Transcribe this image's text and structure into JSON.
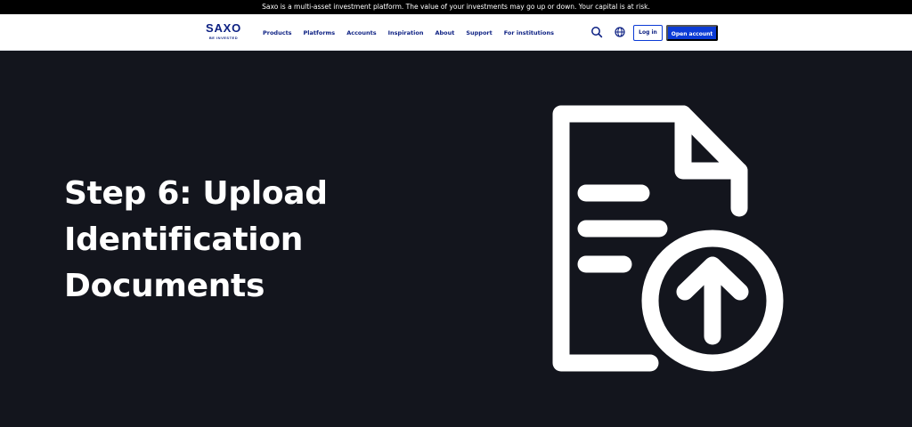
{
  "risk_banner": "Saxo is a multi-asset investment platform. The value of your investments may go up or down. Your capital is at risk.",
  "logo": {
    "name": "SAXO",
    "tagline": "BE INVESTED"
  },
  "nav": {
    "items": [
      {
        "label": "Products"
      },
      {
        "label": "Platforms"
      },
      {
        "label": "Accounts"
      },
      {
        "label": "Inspiration"
      },
      {
        "label": "About"
      },
      {
        "label": "Support"
      },
      {
        "label": "For institutions"
      }
    ],
    "search_icon": "search-icon",
    "language_icon": "globe-icon",
    "login_label": "Log in",
    "open_account_label": "Open account"
  },
  "hero": {
    "title_lines": [
      "Step 6: Upload",
      "Identification",
      "Documents"
    ],
    "illustration_icon": "document-upload-icon"
  },
  "colors": {
    "brand_navy": "#0b1f82",
    "primary_blue": "#0b3bd6",
    "hero_background": "#13151d",
    "hero_text": "#ffffff"
  }
}
